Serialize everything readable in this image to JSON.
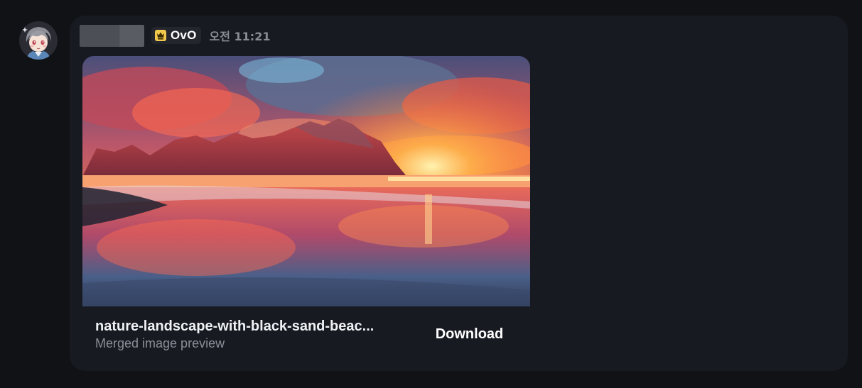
{
  "message": {
    "badge_label": "OvO",
    "time": "오전 11:21",
    "badge_icon": "crown-shield-icon",
    "avatar_icon": "anime-avatar-icon"
  },
  "attachment": {
    "file_name": "nature-landscape-with-black-sand-beac...",
    "subtitle": "Merged image preview",
    "download_label": "Download",
    "image_description_icon": "sunset-beach-landscape-image"
  },
  "colors": {
    "background": "#111216",
    "card": "#181a22",
    "badge_bg": "#24262e",
    "badge_icon": "#f2c94c",
    "muted_text": "#8b8e98"
  }
}
